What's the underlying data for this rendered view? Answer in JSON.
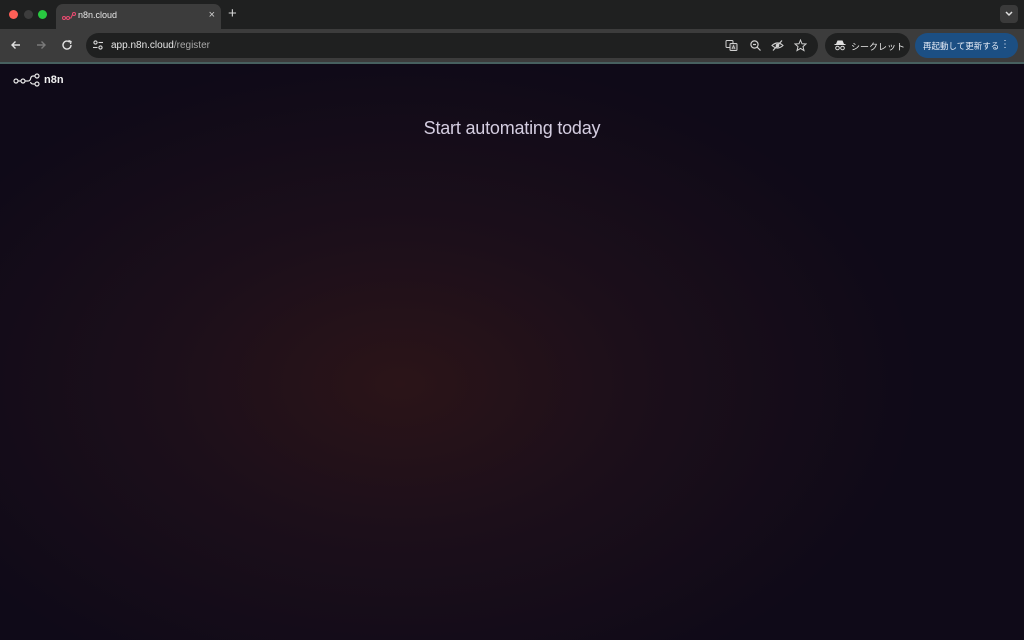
{
  "browser": {
    "tab_title": "n8n.cloud",
    "tab_close": "×",
    "new_tab": "+",
    "url_host": "app.n8n.cloud",
    "url_path": "/register",
    "incognito_label": "シークレット",
    "update_label": "再起動して更新する",
    "update_menu": "⋮",
    "colors": {
      "update_button": "#1c4f83",
      "tab_active": "#3c3c3c",
      "tabstrip": "#1f2020"
    }
  },
  "page": {
    "logo_text": "n8n",
    "headline": "Start automating today",
    "colors": {
      "background": "#0f0a17",
      "glow": "#2b1418",
      "headline": "#d4cde0"
    }
  }
}
